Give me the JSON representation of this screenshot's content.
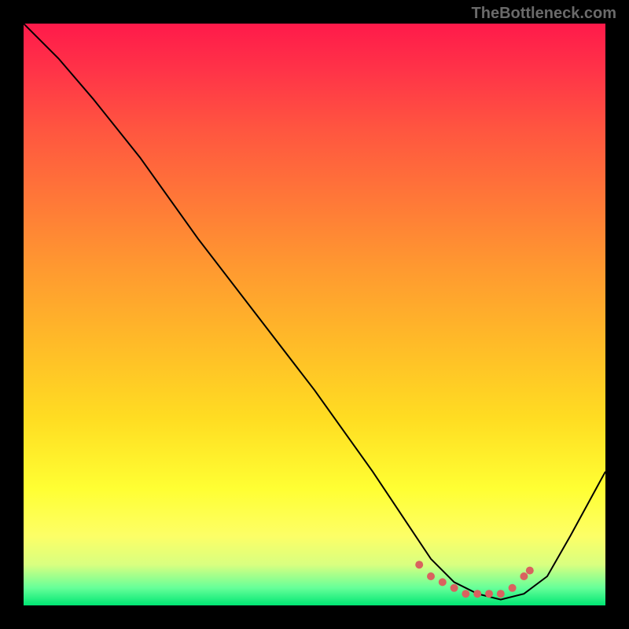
{
  "watermark": "TheBottleneck.com",
  "chart_data": {
    "type": "line",
    "title": "",
    "xlabel": "",
    "ylabel": "",
    "xlim": [
      0,
      100
    ],
    "ylim": [
      0,
      100
    ],
    "series": [
      {
        "name": "bottleneck-curve",
        "x": [
          0,
          6,
          12,
          20,
          30,
          40,
          50,
          60,
          66,
          70,
          74,
          78,
          82,
          86,
          90,
          94,
          100
        ],
        "y": [
          100,
          94,
          87,
          77,
          63,
          50,
          37,
          23,
          14,
          8,
          4,
          2,
          1,
          2,
          5,
          12,
          23
        ]
      }
    ],
    "markers": {
      "name": "highlight-region",
      "x": [
        68,
        70,
        72,
        74,
        76,
        78,
        80,
        82,
        84,
        86,
        87
      ],
      "y": [
        7,
        5,
        4,
        3,
        2,
        2,
        2,
        2,
        3,
        5,
        6
      ]
    },
    "background": "rainbow-gradient-vertical"
  }
}
